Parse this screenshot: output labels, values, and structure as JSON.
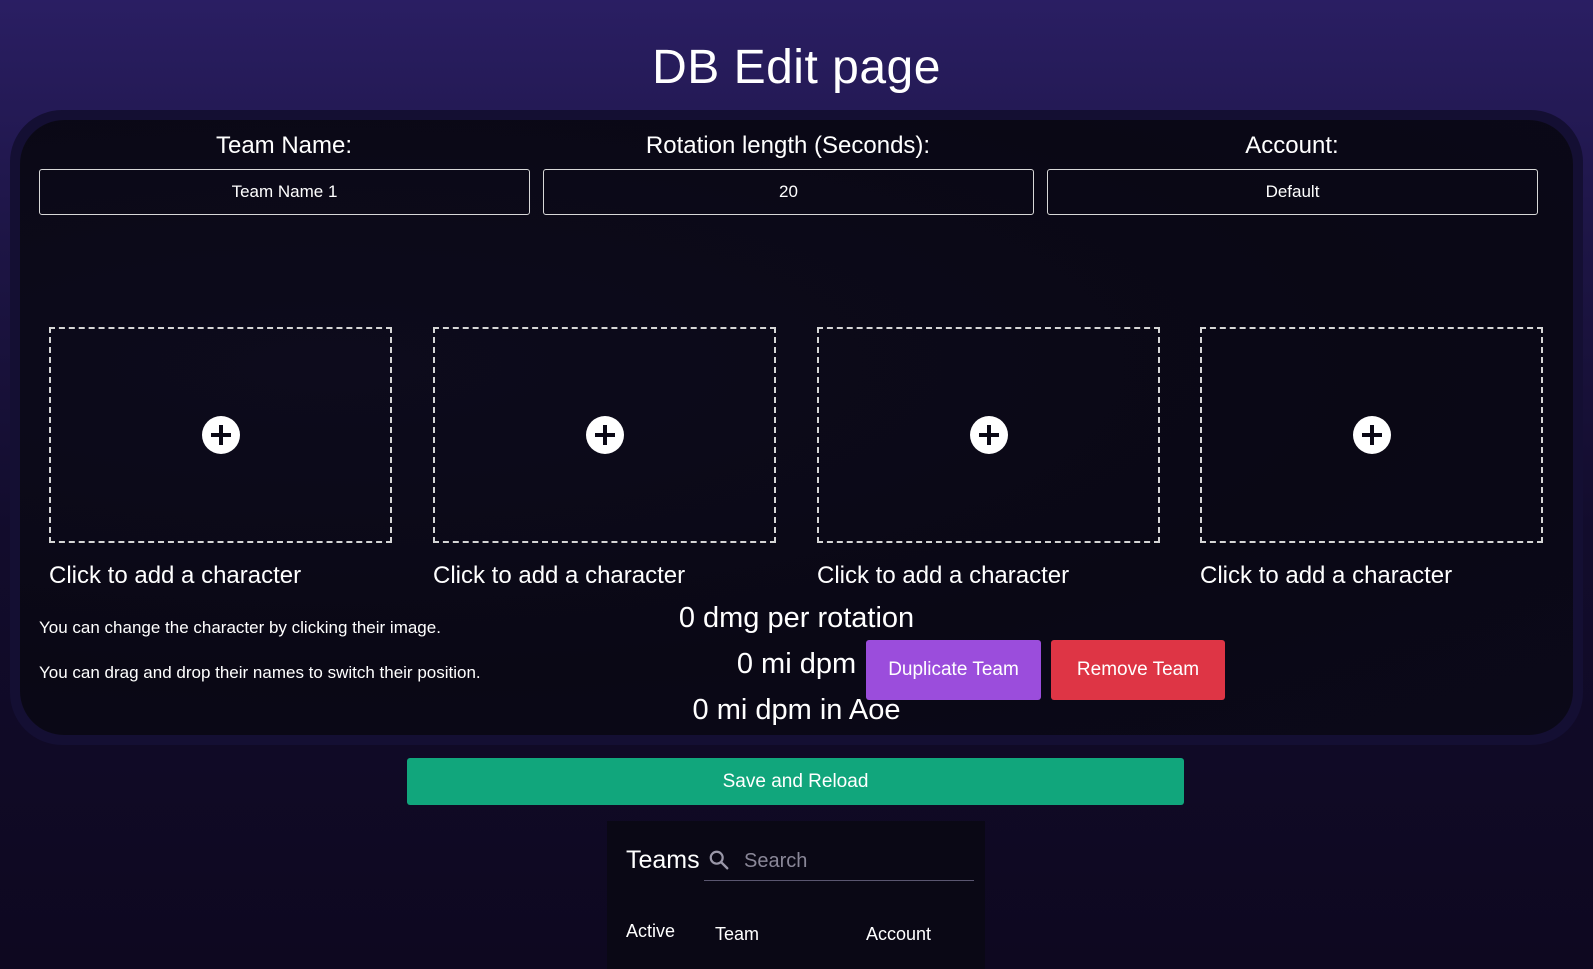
{
  "page": {
    "title": "DB Edit page"
  },
  "team_form": {
    "team_name_label": "Team Name:",
    "team_name_value": "Team Name 1",
    "rotation_label": "Rotation length (Seconds):",
    "rotation_value": "20",
    "account_label": "Account:",
    "account_value": "Default"
  },
  "character_slots": [
    {
      "label": "Click to add a character",
      "icon": "plus-circle-icon"
    },
    {
      "label": "Click to add a character",
      "icon": "plus-circle-icon"
    },
    {
      "label": "Click to add a character",
      "icon": "plus-circle-icon"
    },
    {
      "label": "Click to add a character",
      "icon": "plus-circle-icon"
    }
  ],
  "stats": {
    "dmg_per_rotation": "0 dmg per rotation",
    "mi_dpm": "0 mi dpm",
    "mi_dpm_aoe": "0 mi dpm in Aoe"
  },
  "hints": {
    "change_character": "You can change the character by clicking their image.",
    "drag_drop": "You can drag and drop their names to switch their position."
  },
  "actions": {
    "duplicate_label": "Duplicate Team",
    "remove_label": "Remove Team",
    "save_label": "Save and Reload"
  },
  "teams_table": {
    "title": "Teams",
    "search_placeholder": "Search",
    "columns": [
      "Active",
      "Team",
      "Account"
    ]
  },
  "colors": {
    "duplicate": "#9b4ddc",
    "remove": "#de3545",
    "save": "#11a67c",
    "background_top": "#2a1e63"
  }
}
